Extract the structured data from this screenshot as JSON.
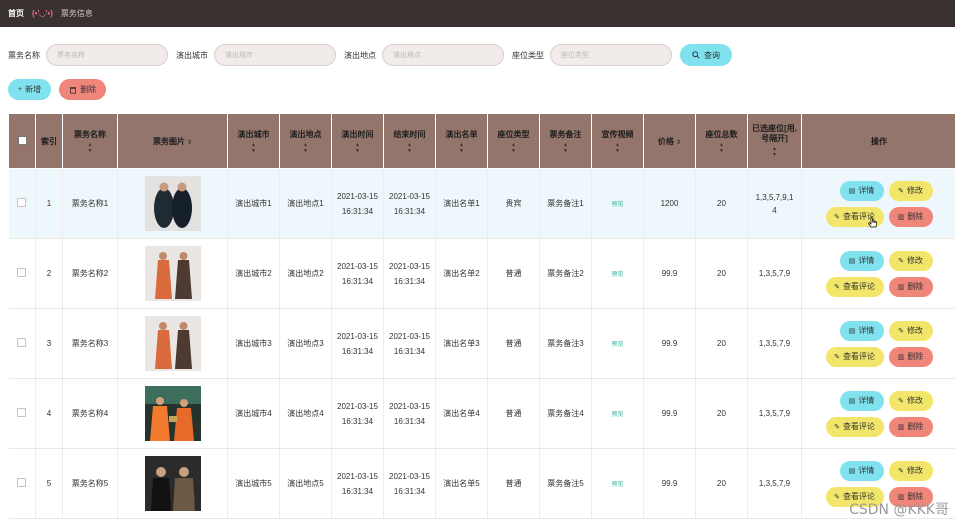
{
  "breadcrumb": {
    "home": "首页",
    "face": "(•'◡'•)",
    "current": "票务信息"
  },
  "search": {
    "fields": [
      {
        "label": "票务名称",
        "placeholder": "票务名称"
      },
      {
        "label": "演出城市",
        "placeholder": "演出城市"
      },
      {
        "label": "演出地点",
        "placeholder": "演出地点"
      },
      {
        "label": "座位类型",
        "placeholder": "座位类型"
      }
    ],
    "query_label": "查询"
  },
  "actions": {
    "add_label": "新增",
    "delete_label": "删除"
  },
  "table": {
    "headers": [
      "索引",
      "票务名称",
      "票务图片",
      "演出城市",
      "演出地点",
      "演出时间",
      "结束时间",
      "演出名单",
      "座位类型",
      "票务备注",
      "宣传视频",
      "价格",
      "座位总数",
      "已选座位[用,号隔开]",
      "操作"
    ],
    "preview_label": "预览",
    "ops": {
      "detail": "详情",
      "edit": "修改",
      "comment": "查看评论",
      "remove": "删除"
    },
    "rows": [
      {
        "index": "1",
        "name": "票务名称1",
        "city": "演出城市1",
        "place": "演出地点1",
        "start": "2021-03-15 16:31:34",
        "end": "2021-03-15 16:31:34",
        "cast": "演出名单1",
        "seat_type": "贵宾",
        "note": "票务备注1",
        "price": "1200",
        "total": "20",
        "selected": "1,3,5,7,9,14",
        "photo": "dark"
      },
      {
        "index": "2",
        "name": "票务名称2",
        "city": "演出城市2",
        "place": "演出地点2",
        "start": "2021-03-15 16:31:34",
        "end": "2021-03-15 16:31:34",
        "cast": "演出名单2",
        "seat_type": "普通",
        "note": "票务备注2",
        "price": "99.9",
        "total": "20",
        "selected": "1,3,5,7,9",
        "photo": "robes"
      },
      {
        "index": "3",
        "name": "票务名称3",
        "city": "演出城市3",
        "place": "演出地点3",
        "start": "2021-03-15 16:31:34",
        "end": "2021-03-15 16:31:34",
        "cast": "演出名单3",
        "seat_type": "普通",
        "note": "票务备注3",
        "price": "99.9",
        "total": "20",
        "selected": "1,3,5,7,9",
        "photo": "robes"
      },
      {
        "index": "4",
        "name": "票务名称4",
        "city": "演出城市4",
        "place": "演出地点4",
        "start": "2021-03-15 16:31:34",
        "end": "2021-03-15 16:31:34",
        "cast": "演出名单4",
        "seat_type": "普通",
        "note": "票务备注4",
        "price": "99.9",
        "total": "20",
        "selected": "1,3,5,7,9",
        "photo": "stage"
      },
      {
        "index": "5",
        "name": "票务名称5",
        "city": "演出城市5",
        "place": "演出地点5",
        "start": "2021-03-15 16:31:34",
        "end": "2021-03-15 16:31:34",
        "cast": "演出名单5",
        "seat_type": "普通",
        "note": "票务备注5",
        "price": "99.9",
        "total": "20",
        "selected": "1,3,5,7,9",
        "photo": "suits"
      }
    ]
  },
  "watermark": "CSDN @KKK哥",
  "colors": {
    "topbar": "#3a3230",
    "header": "#93756c",
    "cyan": "#7fe2ee",
    "yellow": "#f2e66a",
    "red": "#f0857a",
    "highlight_row": "#eef7fb"
  }
}
